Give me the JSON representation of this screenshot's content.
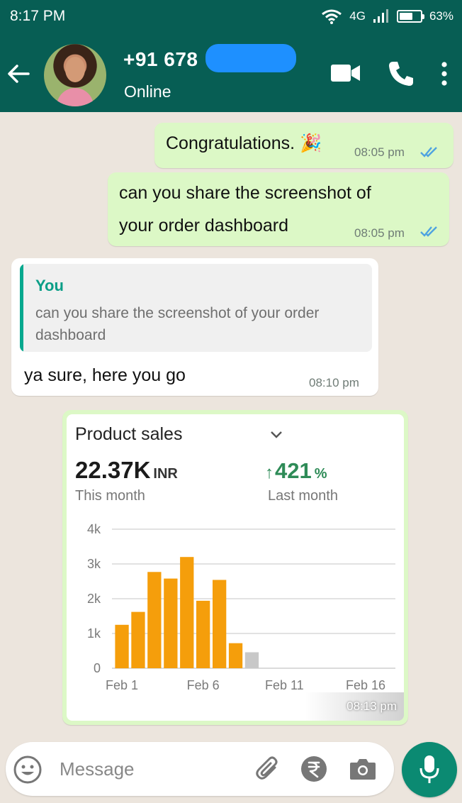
{
  "status_bar": {
    "time": "8:17 PM",
    "network": "4G",
    "battery": "63%",
    "battery_level": 0.63,
    "icons": [
      "wifi-icon",
      "signal-icon",
      "battery-icon"
    ]
  },
  "header": {
    "contact_name": "+91 678",
    "status": "Online",
    "icons": [
      "back-arrow-icon",
      "video-call-icon",
      "voice-call-icon",
      "more-vert-icon"
    ]
  },
  "messages": [
    {
      "direction": "out",
      "text": "Congratulations. 🎉",
      "time": "08:05 pm",
      "ticks": "read"
    },
    {
      "direction": "out",
      "text_lines": [
        "can you share the screenshot of",
        "your order dashboard"
      ],
      "time": "08:05 pm",
      "ticks": "read"
    },
    {
      "direction": "in",
      "quote": {
        "author": "You",
        "text": "can you share the screenshot of your order dashboard"
      },
      "text": "ya sure, here you go",
      "time": "08:10 pm"
    },
    {
      "direction": "out",
      "type": "image",
      "time": "08:13 pm",
      "card": {
        "title": "Product sales",
        "value": "22.37K",
        "unit": "INR",
        "value_label": "This month",
        "change_arrow": "↑",
        "change": "421",
        "change_unit": "%",
        "change_label": "Last month"
      }
    }
  ],
  "chart_data": {
    "type": "bar",
    "xlabel": "",
    "ylabel": "",
    "ylim": [
      0,
      4000
    ],
    "y_ticks": [
      "4k",
      "3k",
      "2k",
      "1k",
      "0"
    ],
    "x_tick_labels": [
      "Feb 1",
      "Feb 6",
      "Feb 11",
      "Feb 16"
    ],
    "x_tick_days": [
      1,
      6,
      11,
      16
    ],
    "grid": true,
    "series": [
      {
        "days": [
          1,
          2,
          3,
          4,
          5,
          6,
          7,
          8
        ],
        "values": [
          1250,
          1620,
          2770,
          2580,
          3200,
          1940,
          2540,
          720
        ],
        "color": "#f59e0b"
      },
      {
        "days": [
          9
        ],
        "values": [
          460
        ],
        "color": "#c8c8c8"
      }
    ]
  },
  "composer": {
    "placeholder": "Message",
    "icons": [
      "emoji-icon",
      "attach-icon",
      "rupee-payment-icon",
      "camera-icon",
      "mic-icon"
    ]
  },
  "colors": {
    "header": "#075e54",
    "outgoing_bubble": "#dcf8c6",
    "incoming_bubble": "#ffffff",
    "read_ticks": "#4fa3e0",
    "bar": "#f59e0b",
    "positive": "#2e8b57",
    "mic_button": "#0b8a72"
  }
}
